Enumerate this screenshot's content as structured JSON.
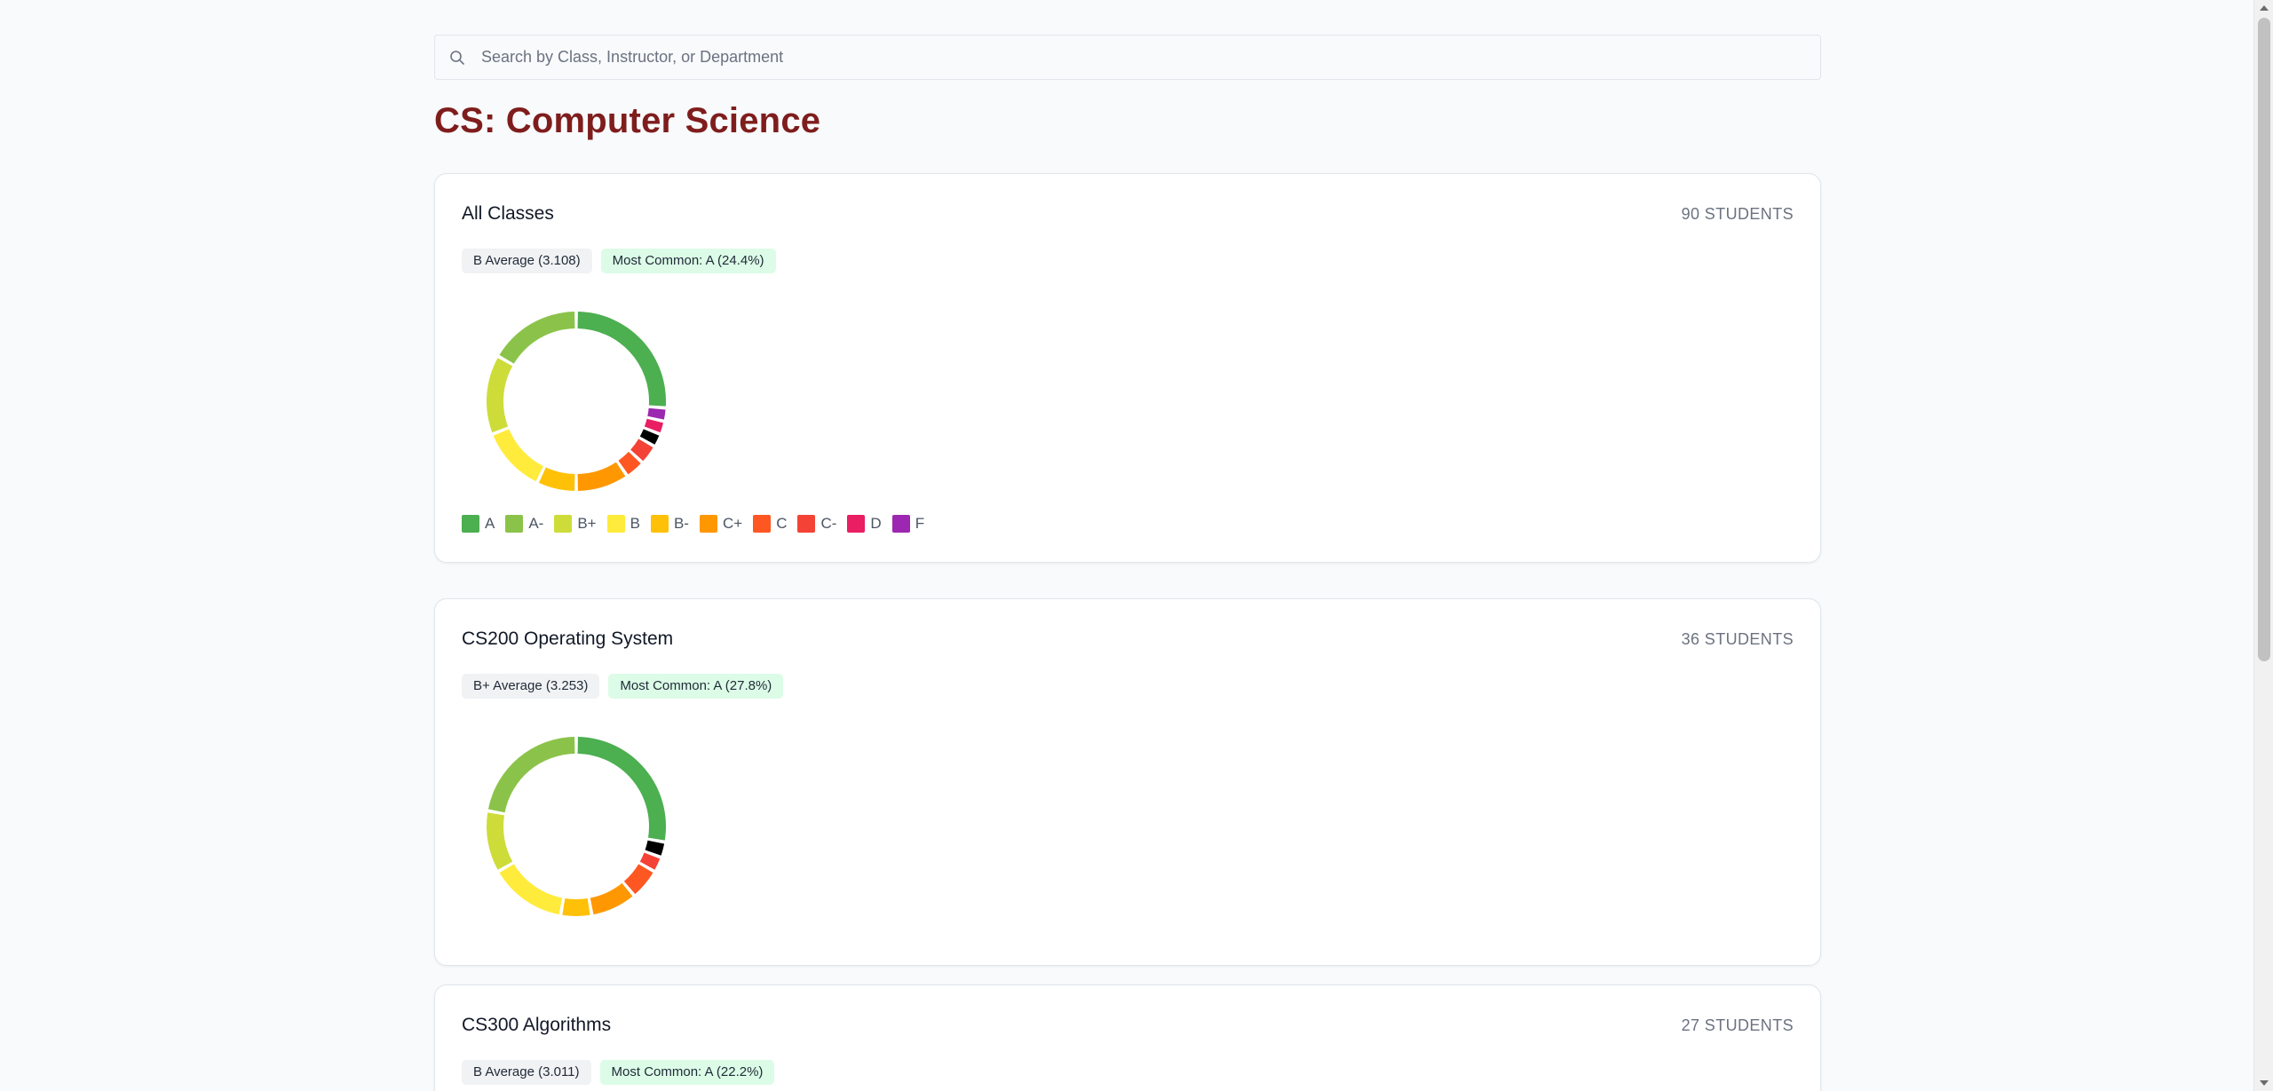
{
  "search": {
    "placeholder": "Search by Class, Instructor, or Department",
    "value": ""
  },
  "department": {
    "title": "CS: Computer Science"
  },
  "legend": [
    {
      "label": "A",
      "color": "#4caf50"
    },
    {
      "label": "A-",
      "color": "#8bc34a"
    },
    {
      "label": "B+",
      "color": "#cddc39"
    },
    {
      "label": "B",
      "color": "#ffeb3b"
    },
    {
      "label": "B-",
      "color": "#ffc107"
    },
    {
      "label": "C+",
      "color": "#ff9800"
    },
    {
      "label": "C",
      "color": "#ff5722"
    },
    {
      "label": "C-",
      "color": "#f44336"
    },
    {
      "label": "D",
      "color": "#e91e63"
    },
    {
      "label": "F",
      "color": "#9c27b0"
    }
  ],
  "extra_colors": {
    "black": "#000000"
  },
  "cards": [
    {
      "title": "All Classes",
      "students": "90 STUDENTS",
      "average": "B Average (3.108)",
      "most_common": "Most Common: A (24.4%)",
      "show_legend": true,
      "chart_data": {
        "type": "pie",
        "style": "donut",
        "categories": [
          "A",
          "A-",
          "B+",
          "B",
          "B-",
          "C+",
          "C",
          "C-",
          "D",
          "F"
        ],
        "slices": [
          {
            "label": "A",
            "value": 22,
            "color": "#4caf50"
          },
          {
            "label": "F",
            "value": 2,
            "color": "#9c27b0"
          },
          {
            "label": "D",
            "value": 2,
            "color": "#e91e63"
          },
          {
            "label": "",
            "value": 2,
            "color": "#000000"
          },
          {
            "label": "C-",
            "value": 3,
            "color": "#f44336"
          },
          {
            "label": "C",
            "value": 3,
            "color": "#ff5722"
          },
          {
            "label": "C+",
            "value": 8,
            "color": "#ff9800"
          },
          {
            "label": "B-",
            "value": 6,
            "color": "#ffc107"
          },
          {
            "label": "B",
            "value": 10,
            "color": "#ffeb3b"
          },
          {
            "label": "B+",
            "value": 12,
            "color": "#cddc39"
          },
          {
            "label": "A-",
            "value": 14,
            "color": "#8bc34a"
          }
        ]
      }
    },
    {
      "title": "CS200 Operating System",
      "students": "36 STUDENTS",
      "average": "B+ Average (3.253)",
      "most_common": "Most Common: A (27.8%)",
      "show_legend": false,
      "chart_data": {
        "type": "pie",
        "style": "donut",
        "slices": [
          {
            "label": "A",
            "value": 10,
            "color": "#4caf50"
          },
          {
            "label": "",
            "value": 1,
            "color": "#000000"
          },
          {
            "label": "C-",
            "value": 1,
            "color": "#f44336"
          },
          {
            "label": "C",
            "value": 2,
            "color": "#ff5722"
          },
          {
            "label": "C+",
            "value": 3,
            "color": "#ff9800"
          },
          {
            "label": "B-",
            "value": 2,
            "color": "#ffc107"
          },
          {
            "label": "B",
            "value": 5,
            "color": "#ffeb3b"
          },
          {
            "label": "B+",
            "value": 4,
            "color": "#cddc39"
          },
          {
            "label": "A-",
            "value": 8,
            "color": "#8bc34a"
          }
        ]
      }
    },
    {
      "title": "CS300 Algorithms",
      "students": "27 STUDENTS",
      "average": "B Average (3.011)",
      "most_common": "Most Common: A (22.2%)",
      "show_legend": false
    }
  ]
}
